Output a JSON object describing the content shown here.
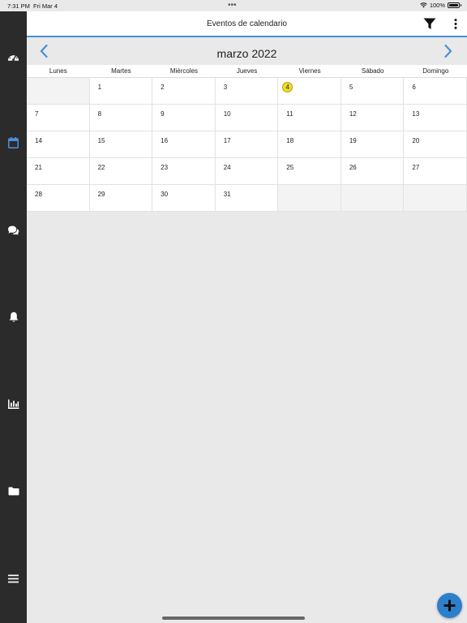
{
  "status_bar": {
    "time": "7:31 PM",
    "date": "Fri Mar 4",
    "dots": "•••",
    "battery": "100%"
  },
  "sidebar": {
    "items": [
      {
        "icon": "dashboard-icon"
      },
      {
        "icon": "calendar-icon",
        "active": true
      },
      {
        "icon": "chat-icon"
      },
      {
        "icon": "bell-icon"
      },
      {
        "icon": "chart-icon"
      },
      {
        "icon": "folder-icon"
      },
      {
        "icon": "menu-icon"
      }
    ]
  },
  "header": {
    "title": "Eventos de calendario"
  },
  "calendar": {
    "month_label": "marzo 2022",
    "weekdays": [
      "Lunes",
      "Martes",
      "Miércoles",
      "Jueves",
      "Viernes",
      "Sábado",
      "Domingo"
    ],
    "leading_empty": 1,
    "days": [
      "1",
      "2",
      "3",
      "4",
      "5",
      "6",
      "7",
      "8",
      "9",
      "10",
      "11",
      "12",
      "13",
      "14",
      "15",
      "16",
      "17",
      "18",
      "19",
      "20",
      "21",
      "22",
      "23",
      "24",
      "25",
      "26",
      "27",
      "28",
      "29",
      "30",
      "31"
    ],
    "today": "4",
    "trailing_empty": 3
  },
  "colors": {
    "accent": "#4a90d9",
    "sidebar": "#2b2b2b",
    "today": "#f0dc28",
    "fab": "#2e7fcb"
  }
}
